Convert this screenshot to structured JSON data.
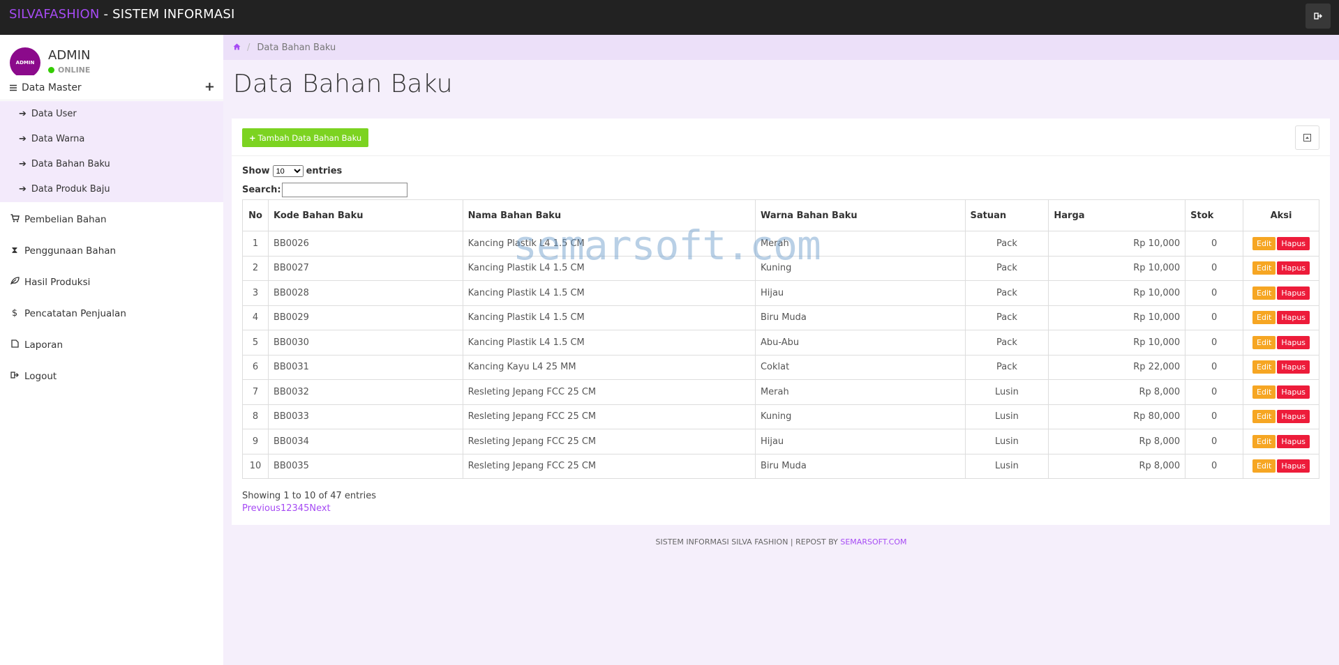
{
  "topbar": {
    "brand_accent": "SILVAFASHION",
    "brand_rest": " - SISTEM INFORMASI",
    "accent_color": "#a64bf4"
  },
  "user": {
    "avatar_text": "ADMIN",
    "name": "ADMIN",
    "status": "ONLINE"
  },
  "sidebar": {
    "group": {
      "label": "Data Master",
      "expand_icon": "plus-icon"
    },
    "sub_items": [
      {
        "label": "Data User"
      },
      {
        "label": "Data Warna"
      },
      {
        "label": "Data Bahan Baku"
      },
      {
        "label": "Data Produk Baju"
      }
    ],
    "items": [
      {
        "label": "Pembelian Bahan",
        "icon": "cart-icon"
      },
      {
        "label": "Penggunaan Bahan",
        "icon": "hourglass-icon"
      },
      {
        "label": "Hasil Produksi",
        "icon": "leaf-icon"
      },
      {
        "label": "Pencatatan Penjualan",
        "icon": "dollar-icon"
      },
      {
        "label": "Laporan",
        "icon": "document-icon"
      },
      {
        "label": "Logout",
        "icon": "logout-icon"
      }
    ]
  },
  "breadcrumb": {
    "current": "Data Bahan Baku"
  },
  "page": {
    "title": "Data Bahan Baku"
  },
  "panel": {
    "add_label": "Tambah Data Bahan Baku"
  },
  "datatable": {
    "show_label": "Show",
    "entries_label": "entries",
    "page_size": "10",
    "search_label": "Search:",
    "columns": [
      "No",
      "Kode Bahan Baku",
      "Nama Bahan Baku",
      "Warna Bahan Baku",
      "Satuan",
      "Harga",
      "Stok",
      "Aksi"
    ],
    "edit_label": "Edit",
    "delete_label": "Hapus",
    "rows": [
      {
        "no": "1",
        "kode": "BB0026",
        "nama": "Kancing Plastik L4 1.5 CM",
        "warna": "Merah",
        "satuan": "Pack",
        "harga": "Rp 10,000",
        "stok": "0"
      },
      {
        "no": "2",
        "kode": "BB0027",
        "nama": "Kancing Plastik L4 1.5 CM",
        "warna": "Kuning",
        "satuan": "Pack",
        "harga": "Rp 10,000",
        "stok": "0"
      },
      {
        "no": "3",
        "kode": "BB0028",
        "nama": "Kancing Plastik L4 1.5 CM",
        "warna": "Hijau",
        "satuan": "Pack",
        "harga": "Rp 10,000",
        "stok": "0"
      },
      {
        "no": "4",
        "kode": "BB0029",
        "nama": "Kancing Plastik L4 1.5 CM",
        "warna": "Biru Muda",
        "satuan": "Pack",
        "harga": "Rp 10,000",
        "stok": "0"
      },
      {
        "no": "5",
        "kode": "BB0030",
        "nama": "Kancing Plastik L4 1.5 CM",
        "warna": "Abu-Abu",
        "satuan": "Pack",
        "harga": "Rp 10,000",
        "stok": "0"
      },
      {
        "no": "6",
        "kode": "BB0031",
        "nama": "Kancing Kayu L4 25 MM",
        "warna": "Coklat",
        "satuan": "Pack",
        "harga": "Rp 22,000",
        "stok": "0"
      },
      {
        "no": "7",
        "kode": "BB0032",
        "nama": "Resleting Jepang FCC 25 CM",
        "warna": "Merah",
        "satuan": "Lusin",
        "harga": "Rp 8,000",
        "stok": "0"
      },
      {
        "no": "8",
        "kode": "BB0033",
        "nama": "Resleting Jepang FCC 25 CM",
        "warna": "Kuning",
        "satuan": "Lusin",
        "harga": "Rp 80,000",
        "stok": "0"
      },
      {
        "no": "9",
        "kode": "BB0034",
        "nama": "Resleting Jepang FCC 25 CM",
        "warna": "Hijau",
        "satuan": "Lusin",
        "harga": "Rp 8,000",
        "stok": "0"
      },
      {
        "no": "10",
        "kode": "BB0035",
        "nama": "Resleting Jepang FCC 25 CM",
        "warna": "Biru Muda",
        "satuan": "Lusin",
        "harga": "Rp 8,000",
        "stok": "0"
      }
    ],
    "info": "Showing 1 to 10 of 47 entries",
    "pagination": [
      "Previous",
      "1",
      "2",
      "3",
      "4",
      "5",
      "Next"
    ]
  },
  "footer": {
    "text": "SISTEM INFORMASI SILVA FASHION | REPOST BY ",
    "link": "SEMARSOFT.COM"
  },
  "watermark": "semarsoft.com"
}
